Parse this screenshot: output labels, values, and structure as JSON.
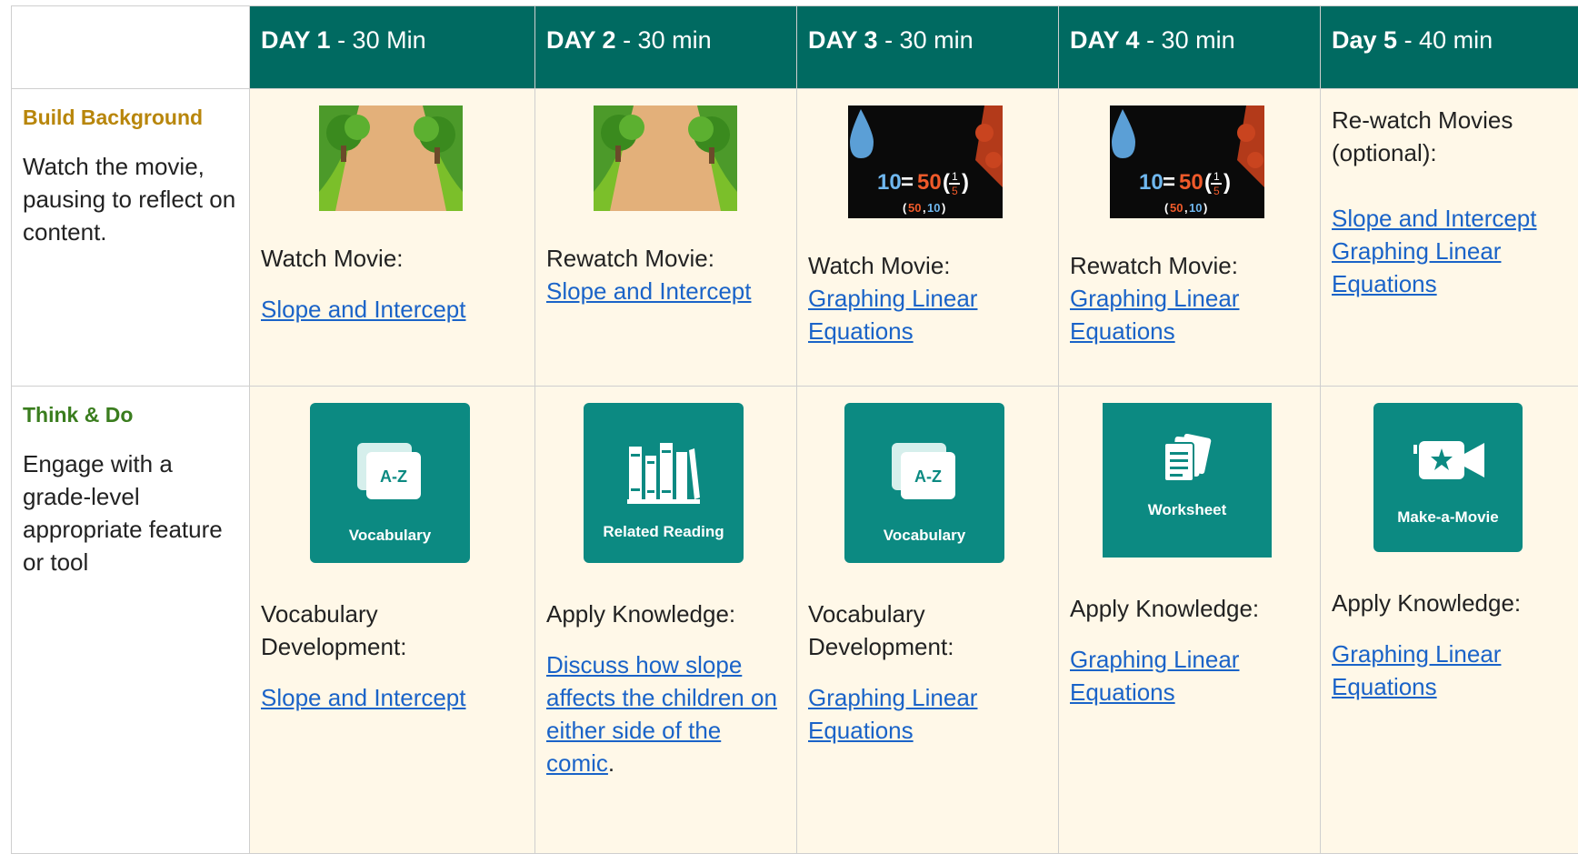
{
  "header": {
    "days": [
      {
        "day": "DAY 1",
        "time": " - 30 Min"
      },
      {
        "day": "DAY 2",
        "time": " - 30 min"
      },
      {
        "day": "DAY 3",
        "time": " - 30 min"
      },
      {
        "day": "DAY 4",
        "time": " - 30 min"
      },
      {
        "day": "Day 5",
        "time": " - 40 min"
      }
    ]
  },
  "rows": {
    "build": {
      "title": "Build Background",
      "title_color": "#b8860b",
      "desc": "Watch the movie, pausing to reflect on content.",
      "cells": [
        {
          "label": "Watch Movie:",
          "link": "Slope and Intercept"
        },
        {
          "label": "Rewatch Movie:",
          "link": "Slope and Intercept"
        },
        {
          "label": "Watch Movie:",
          "link": "Graphing Linear Equations"
        },
        {
          "label": "Rewatch Movie:",
          "link": "Graphing Linear Equations"
        },
        {
          "label": "Re-watch Movies (optional):",
          "link1": "Slope and Intercept",
          "link2": "Graphing Linear Equations"
        }
      ],
      "thumb_text": {
        "eq_left": "10",
        "eq_eq": "=",
        "eq_50": "50",
        "num": "1",
        "den": "5",
        "pair_a": "50",
        "pair_b": "10"
      }
    },
    "think": {
      "title": "Think & Do",
      "title_color": "#3a7d1e",
      "desc": "Engage with a grade-level appropriate feature or tool",
      "cells": [
        {
          "tile": "Vocabulary",
          "tile_icon_text": "A-Z",
          "label": "Vocabulary Development:",
          "link": "Slope and Intercept"
        },
        {
          "tile": "Related Reading",
          "label": "Apply Knowledge:",
          "link": "Discuss how slope affects the children on either side of the comic",
          "suffix": "."
        },
        {
          "tile": "Vocabulary",
          "tile_icon_text": "A-Z",
          "label": "Vocabulary Development:",
          "link": "Graphing Linear Equations"
        },
        {
          "tile": "Worksheet",
          "label": "Apply Knowledge:",
          "link": "Graphing Linear Equations"
        },
        {
          "tile": "Make-a-Movie",
          "label": "Apply Knowledge:",
          "link": "Graphing Linear Equations"
        }
      ]
    }
  },
  "colors": {
    "header_bg": "#006a61",
    "tile_bg": "#0c8a82",
    "cream": "#fff8e8",
    "link": "#1a63c8"
  }
}
